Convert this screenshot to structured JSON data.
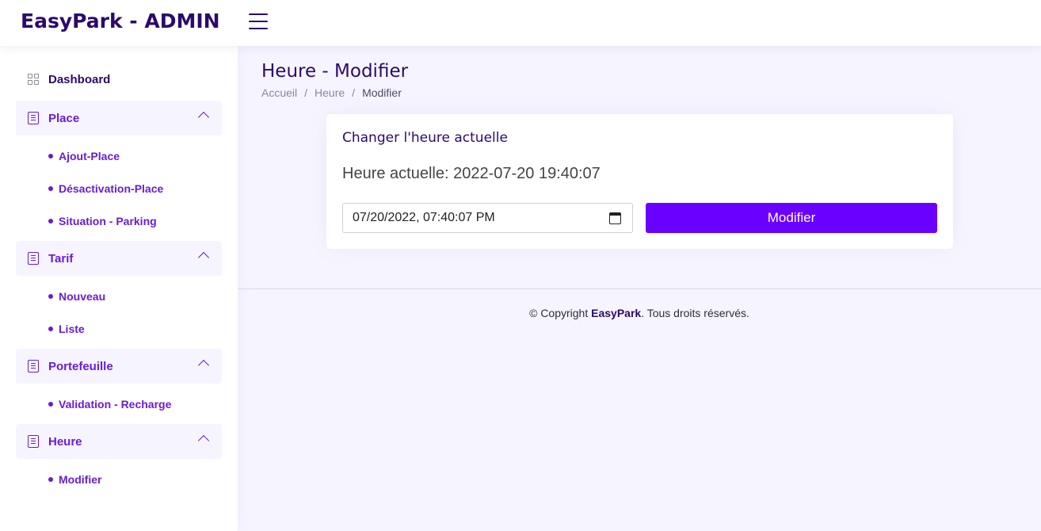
{
  "header": {
    "logo": "EasyPark - ADMIN"
  },
  "sidebar": {
    "dashboard": "Dashboard",
    "groups": [
      {
        "label": "Place",
        "items": [
          "Ajout-Place",
          "Désactivation-Place",
          "Situation - Parking"
        ]
      },
      {
        "label": "Tarif",
        "items": [
          "Nouveau",
          "Liste"
        ]
      },
      {
        "label": "Portefeuille",
        "items": [
          "Validation - Recharge"
        ]
      },
      {
        "label": "Heure",
        "items": [
          "Modifier"
        ]
      }
    ]
  },
  "main": {
    "title": "Heure - Modifier",
    "breadcrumb": [
      "Accueil",
      "Heure",
      "Modifier"
    ],
    "card": {
      "title": "Changer l'heure actuelle",
      "current_time": "Heure actuelle: 2022-07-20 19:40:07",
      "input_value": "07/20/2022, 07:40:07 PM",
      "button": "Modifier"
    }
  },
  "footer": {
    "prefix": "© Copyright ",
    "brand": "EasyPark",
    "suffix": ". Tous droits réservés."
  },
  "colors": {
    "accent": "#6a00ff",
    "nav": "#6a1bd6",
    "heading": "#2b0a6b",
    "background": "#f6f5ff"
  },
  "icons": {
    "menu": "hamburger-icon",
    "dashboard": "grid-icon",
    "group": "document-list-icon",
    "chevron": "chevron-up-icon",
    "calendar": "calendar-icon"
  }
}
